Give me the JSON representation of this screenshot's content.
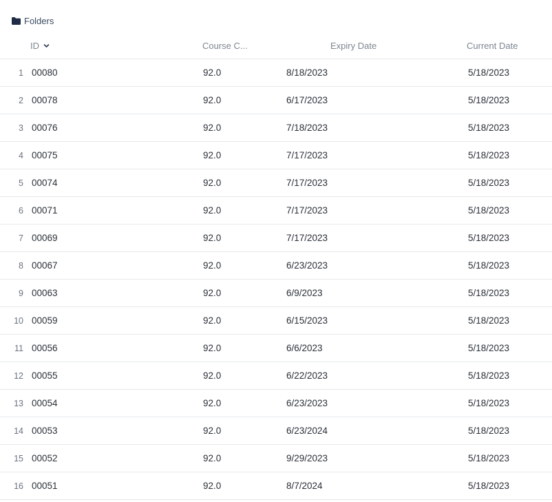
{
  "folders": {
    "label": "Folders",
    "icon": "folder-icon"
  },
  "columns": {
    "id": "ID",
    "course": "Course C...",
    "expiry": "Expiry Date",
    "current": "Current Date",
    "sort_icon": "chevron-down-icon"
  },
  "rows": [
    {
      "num": "1",
      "id": "00080",
      "course": "92.0",
      "expiry": "8/18/2023",
      "current": "5/18/2023"
    },
    {
      "num": "2",
      "id": "00078",
      "course": "92.0",
      "expiry": "6/17/2023",
      "current": "5/18/2023"
    },
    {
      "num": "3",
      "id": "00076",
      "course": "92.0",
      "expiry": "7/18/2023",
      "current": "5/18/2023"
    },
    {
      "num": "4",
      "id": "00075",
      "course": "92.0",
      "expiry": "7/17/2023",
      "current": "5/18/2023"
    },
    {
      "num": "5",
      "id": "00074",
      "course": "92.0",
      "expiry": "7/17/2023",
      "current": "5/18/2023"
    },
    {
      "num": "6",
      "id": "00071",
      "course": "92.0",
      "expiry": "7/17/2023",
      "current": "5/18/2023"
    },
    {
      "num": "7",
      "id": "00069",
      "course": "92.0",
      "expiry": "7/17/2023",
      "current": "5/18/2023"
    },
    {
      "num": "8",
      "id": "00067",
      "course": "92.0",
      "expiry": "6/23/2023",
      "current": "5/18/2023"
    },
    {
      "num": "9",
      "id": "00063",
      "course": "92.0",
      "expiry": "6/9/2023",
      "current": "5/18/2023"
    },
    {
      "num": "10",
      "id": "00059",
      "course": "92.0",
      "expiry": "6/15/2023",
      "current": "5/18/2023"
    },
    {
      "num": "11",
      "id": "00056",
      "course": "92.0",
      "expiry": "6/6/2023",
      "current": "5/18/2023"
    },
    {
      "num": "12",
      "id": "00055",
      "course": "92.0",
      "expiry": "6/22/2023",
      "current": "5/18/2023"
    },
    {
      "num": "13",
      "id": "00054",
      "course": "92.0",
      "expiry": "6/23/2023",
      "current": "5/18/2023"
    },
    {
      "num": "14",
      "id": "00053",
      "course": "92.0",
      "expiry": "6/23/2024",
      "current": "5/18/2023"
    },
    {
      "num": "15",
      "id": "00052",
      "course": "92.0",
      "expiry": "9/29/2023",
      "current": "5/18/2023"
    },
    {
      "num": "16",
      "id": "00051",
      "course": "92.0",
      "expiry": "8/7/2024",
      "current": "5/18/2023"
    }
  ]
}
